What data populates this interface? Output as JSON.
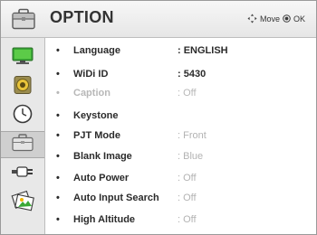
{
  "header": {
    "title": "OPTION",
    "hint_move": "Move",
    "hint_ok": "OK"
  },
  "sidebar": {
    "items": [
      {
        "icon": "tv-screen-icon",
        "selected": false
      },
      {
        "icon": "speaker-icon",
        "selected": false
      },
      {
        "icon": "clock-icon",
        "selected": false
      },
      {
        "icon": "briefcase-icon",
        "selected": true
      },
      {
        "icon": "connector-icon",
        "selected": false
      },
      {
        "icon": "photo-icon",
        "selected": false
      }
    ]
  },
  "menu": {
    "rows": [
      {
        "bullet": "•",
        "label": "Language",
        "value": ": ENGLISH",
        "enabled": true
      },
      {
        "bullet": "•",
        "label": "WiDi ID",
        "value": ": 5430",
        "enabled": true
      },
      {
        "bullet": "•",
        "label": "Caption",
        "value": ": Off",
        "enabled": false
      },
      {
        "bullet": "•",
        "label": "Keystone",
        "value": "",
        "enabled": true
      },
      {
        "bullet": "•",
        "label": "PJT Mode",
        "value": ": Front",
        "enabled": true,
        "value_dim": true
      },
      {
        "bullet": "•",
        "label": "Blank Image",
        "value": ": Blue",
        "enabled": true,
        "value_dim": true
      },
      {
        "bullet": "•",
        "label": "Auto Power",
        "value": ": Off",
        "enabled": true,
        "value_dim": true
      },
      {
        "bullet": "•",
        "label": "Auto Input Search",
        "value": ": Off",
        "enabled": true,
        "value_dim": true
      },
      {
        "bullet": "•",
        "label": "High Altitude",
        "value": ": Off",
        "enabled": true,
        "value_dim": true
      }
    ]
  },
  "colors": {
    "text": "#2b2b2b",
    "disabled": "#b8b8b8",
    "sidebar_bg": "#e8e8e8",
    "selected_bg": "#cfcfcf"
  }
}
